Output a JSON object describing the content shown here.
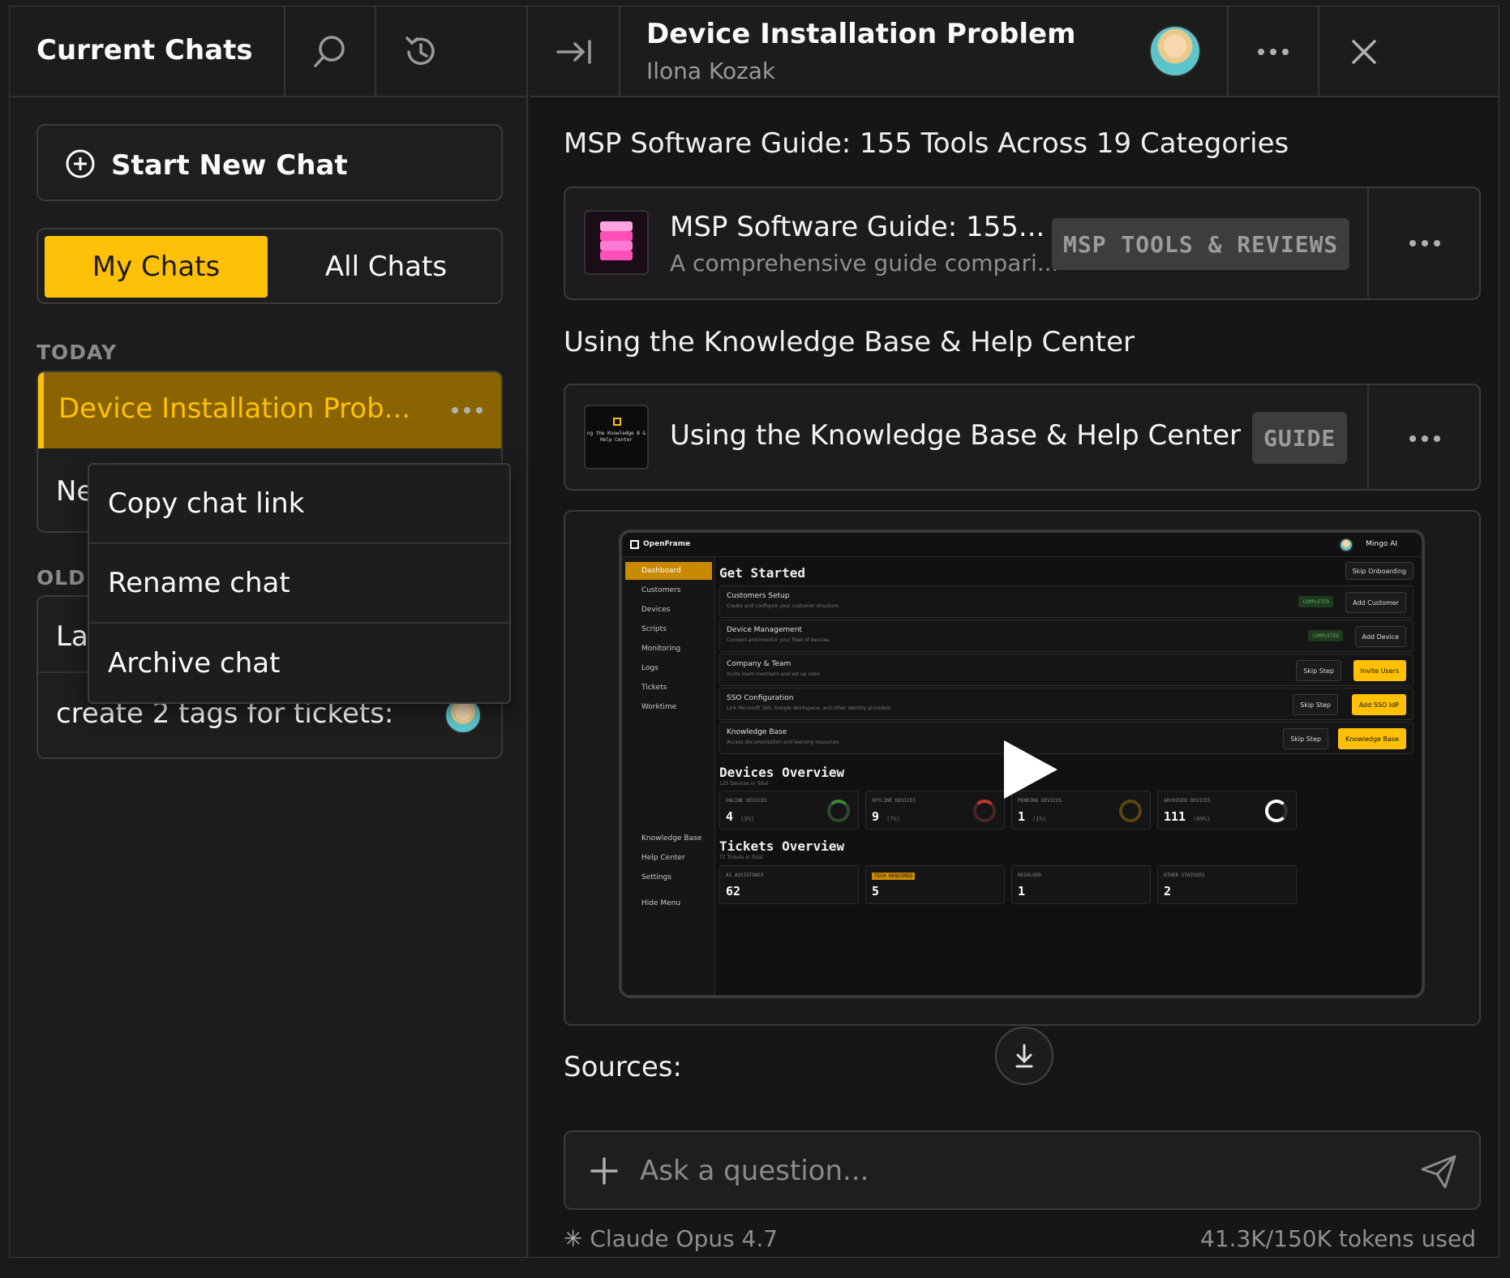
{
  "left": {
    "title": "Current Chats",
    "new_chat_label": "Start New Chat",
    "tabs": [
      {
        "label": "My Chats",
        "active": true
      },
      {
        "label": "All Chats",
        "active": false
      }
    ],
    "sections": {
      "today": "TODAY",
      "older": "OLDE"
    },
    "today_items": [
      {
        "label": "Device Installation Prob...",
        "selected": true
      },
      {
        "label": "Ne"
      }
    ],
    "older_items": [
      {
        "label": "La"
      },
      {
        "label": "create 2 tags for tickets:"
      }
    ],
    "context_menu": [
      "Copy chat link",
      "Rename chat",
      "Archive chat"
    ]
  },
  "header": {
    "title": "Device Installation Problem",
    "subtitle": "Ilona Kozak"
  },
  "main": {
    "section1": "MSP Software Guide: 155 Tools Across 19 Categories",
    "card1": {
      "title": "MSP Software Guide: 155...",
      "subtitle": "A comprehensive guide compari...",
      "badge": "MSP TOOLS & REVIEWS"
    },
    "section2": "Using the Knowledge Base & Help Center",
    "card2": {
      "title": "Using the Knowledge Base & Help Center",
      "badge": "GUIDE",
      "thumb_text": "ng the Knowledge B & Help Center"
    },
    "video": {
      "brand": "OpenFrame",
      "user": "Mingo AI",
      "nav": [
        "Dashboard",
        "Customers",
        "Devices",
        "Scripts",
        "Monitoring",
        "Logs",
        "Tickets",
        "Worktime"
      ],
      "nav_bottom": [
        "Knowledge Base",
        "Help Center",
        "Settings"
      ],
      "hide_menu": "Hide Menu",
      "get_started": "Get Started",
      "skip_onboarding": "Skip Onboarding",
      "steps": [
        {
          "title": "Customers Setup",
          "desc": "Create and configure your customer structure",
          "tag": "COMPLETED",
          "action": "Add Customer"
        },
        {
          "title": "Device Management",
          "desc": "Connect and monitor your fleet of devices",
          "tag": "COMPLETED",
          "action": "Add Device"
        },
        {
          "title": "Company & Team",
          "desc": "Invite team members and set up roles",
          "skip": "Skip Step",
          "action": "Invite Users"
        },
        {
          "title": "SSO Configuration",
          "desc": "Link Microsoft 365, Google Workspace, and other identity providers",
          "skip": "Skip Step",
          "action": "Add SSO IdP"
        },
        {
          "title": "Knowledge Base",
          "desc": "Access documentation and learning resources",
          "skip": "Skip Step",
          "action": "Knowledge Base"
        }
      ],
      "devices_title": "Devices Overview",
      "devices_sub": "125 Devices in Total",
      "devices": [
        {
          "label": "ONLINE DEVICES",
          "value": "4",
          "pct": "(3%)",
          "color": "#3b8a3b"
        },
        {
          "label": "OFFLINE DEVICES",
          "value": "9",
          "pct": "(7%)",
          "color": "#c0392b"
        },
        {
          "label": "PENDING DEVICES",
          "value": "1",
          "pct": "(1%)",
          "color": "#c98a00"
        },
        {
          "label": "ARCHIVED DEVICES",
          "value": "111",
          "pct": "(89%)",
          "color": "#ffffff"
        }
      ],
      "tickets_title": "Tickets Overview",
      "tickets_sub": "71 Tickets in Total",
      "tickets": [
        {
          "label": "AI ASSISTANCE",
          "value": "62"
        },
        {
          "label": "TECH REQUIRED",
          "value": "5"
        },
        {
          "label": "RESOLVED",
          "value": "1"
        },
        {
          "label": "OTHER STATUSES",
          "value": "2"
        }
      ]
    },
    "sources_label": "Sources:",
    "ask_placeholder": "Ask a question...",
    "model": "Claude Opus 4.7",
    "tokens": "41.3K/150K tokens used"
  },
  "colors": {
    "accent": "#ffc107",
    "selected_bg": "#8a6400",
    "background": "#161616"
  }
}
